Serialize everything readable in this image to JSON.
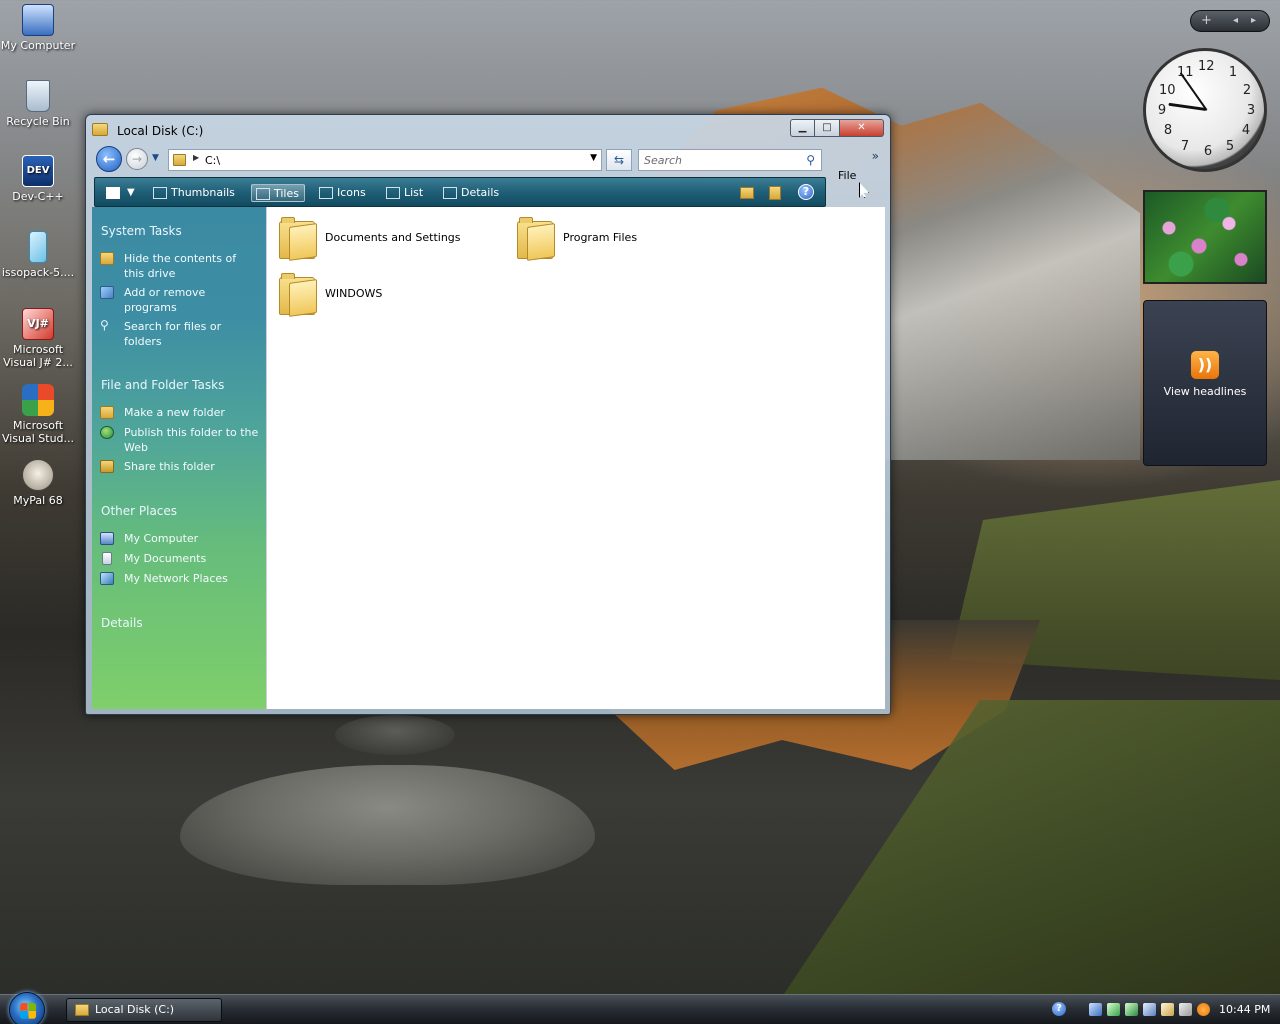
{
  "desktop": {
    "icons": [
      {
        "label": "My Computer"
      },
      {
        "label": "Recycle Bin"
      },
      {
        "label": "Dev-C++"
      },
      {
        "label": "issopack-5...."
      },
      {
        "label": "Microsoft Visual J# 2..."
      },
      {
        "label": "Microsoft Visual Stud..."
      },
      {
        "label": "MyPal 68"
      }
    ]
  },
  "gadgets": {
    "sidebar_controls": {
      "add": "+",
      "prev": "◂",
      "next": "▸"
    },
    "clock": {
      "numbers": [
        "12",
        "1",
        "2",
        "3",
        "4",
        "5",
        "6",
        "7",
        "8",
        "9",
        "10",
        "11"
      ]
    },
    "feeds": {
      "label": "View headlines"
    }
  },
  "window": {
    "title": "Local Disk (C:)",
    "address": "C:\\",
    "search_placeholder": "Search",
    "menu": {
      "file": "File",
      "overflow": "»"
    },
    "toolbar": {
      "thumbnails": "Thumbnails",
      "tiles": "Tiles",
      "icons": "Icons",
      "list": "List",
      "details": "Details",
      "help": "?"
    },
    "tasks": {
      "system_tasks": {
        "title": "System Tasks",
        "items": [
          "Hide the contents of this drive",
          "Add or remove programs",
          "Search for files or folders"
        ]
      },
      "file_folder_tasks": {
        "title": "File and Folder Tasks",
        "items": [
          "Make a new folder",
          "Publish this folder to the Web",
          "Share this folder"
        ]
      },
      "other_places": {
        "title": "Other Places",
        "items": [
          "My Computer",
          "My Documents",
          "My Network Places"
        ]
      },
      "details": {
        "title": "Details"
      }
    },
    "folders": [
      {
        "name": "Documents and Settings"
      },
      {
        "name": "Program Files"
      },
      {
        "name": "WINDOWS"
      }
    ]
  },
  "taskbar": {
    "task": "Local Disk (C:)",
    "time": "10:44 PM",
    "tray_help": "?"
  }
}
